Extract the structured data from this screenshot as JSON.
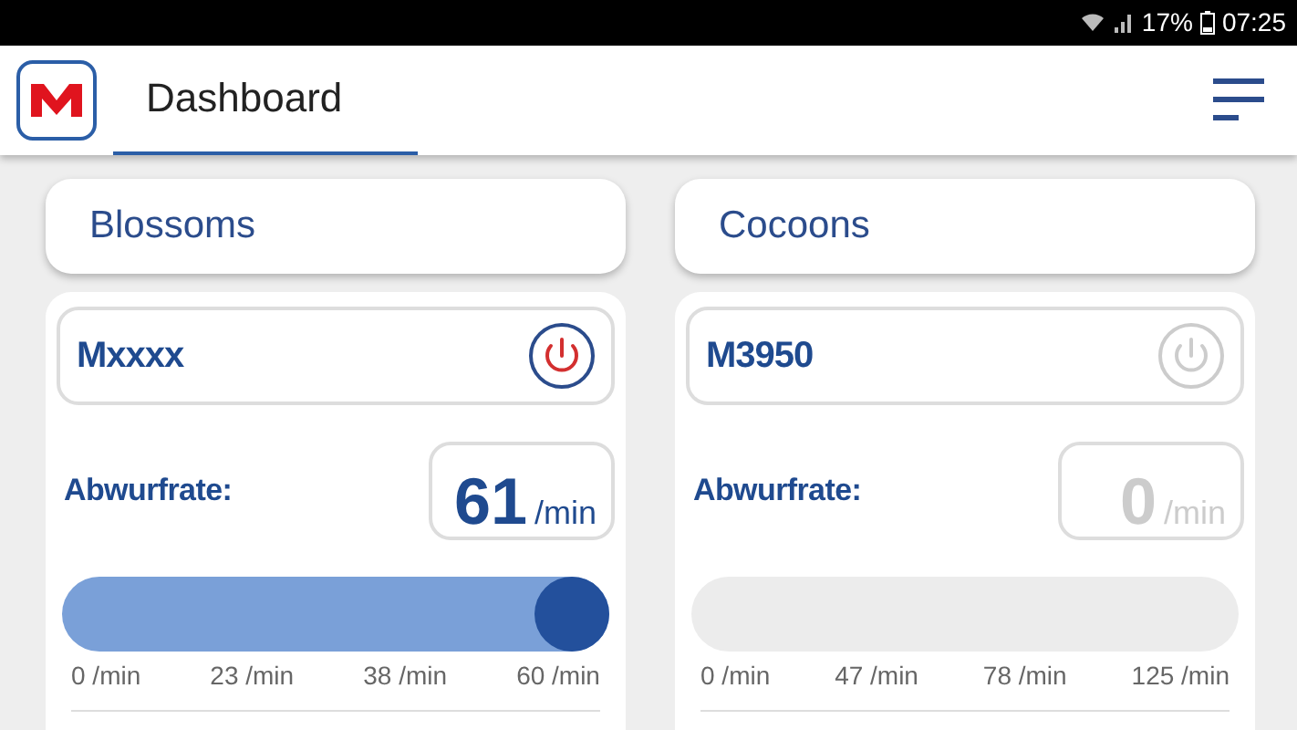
{
  "status_bar": {
    "battery": "17%",
    "time": "07:25"
  },
  "header": {
    "title": "Dashboard"
  },
  "columns": [
    {
      "title": "Blossoms",
      "machine": {
        "name": "Mxxxx",
        "on": true,
        "rate_label": "Abwurfrate:",
        "rate": "61",
        "unit": "/min",
        "level": 1,
        "ticks": [
          "0 /min",
          "23 /min",
          "38 /min",
          "60 /min"
        ]
      }
    },
    {
      "title": "Cocoons",
      "machine": {
        "name": "M3950",
        "on": false,
        "rate_label": "Abwurfrate:",
        "rate": "0",
        "unit": "/min",
        "ticks": [
          "0 /min",
          "47 /min",
          "78 /min",
          "125 /min"
        ]
      }
    }
  ]
}
